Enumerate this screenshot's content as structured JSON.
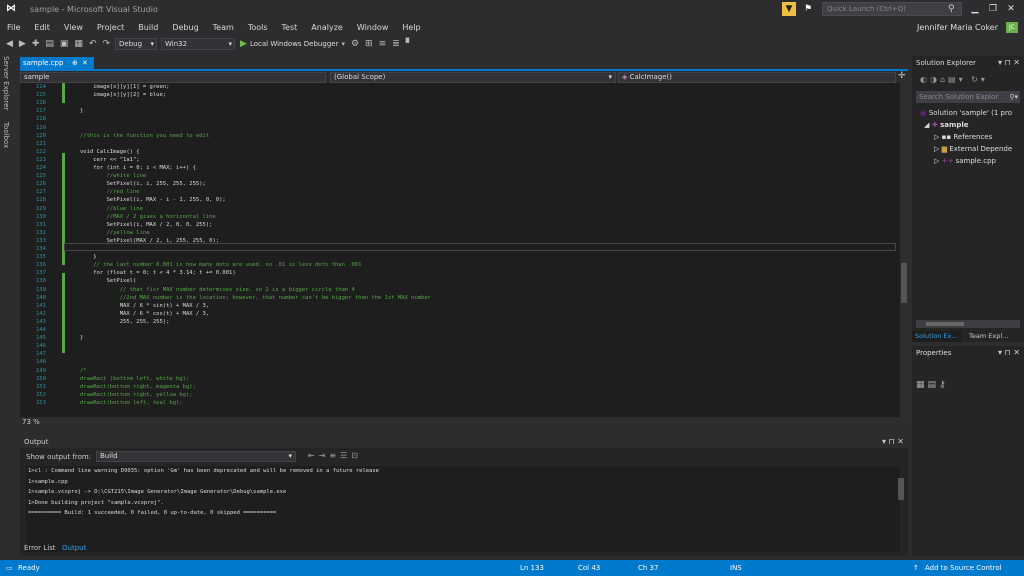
{
  "titlebar": {
    "title": "sample - Microsoft Visual Studio",
    "quick_launch_placeholder": "Quick Launch (Ctrl+Q)"
  },
  "menu": [
    "File",
    "Edit",
    "View",
    "Project",
    "Build",
    "Debug",
    "Team",
    "Tools",
    "Test",
    "Analyze",
    "Window",
    "Help"
  ],
  "user": {
    "name": "Jennifer Maria Coker",
    "initials": "JC",
    "avatar_color": "#69b04a"
  },
  "toolbar": {
    "config": "Debug",
    "platform": "Win32",
    "run_label": "Local Windows Debugger"
  },
  "left_tabs": [
    "Server Explorer",
    "Toolbox"
  ],
  "editor": {
    "tab_label": "sample.cpp",
    "nav_project": "sample",
    "nav_scope": "(Global Scope)",
    "nav_member": "CalcImage()",
    "zoom": "73 %",
    "lines": [
      {
        "n": "114",
        "code": "    image[x][y][1] = green;"
      },
      {
        "n": "115",
        "code": "    image[x][y][2] = blue;"
      },
      {
        "n": "116",
        "code": ""
      },
      {
        "n": "117",
        "code": "}"
      },
      {
        "n": "118",
        "code": ""
      },
      {
        "n": "119",
        "code": ""
      },
      {
        "n": "120",
        "code": "//this is the function you need to edit"
      },
      {
        "n": "121",
        "code": ""
      },
      {
        "n": "122",
        "code": "void CalcImage() {"
      },
      {
        "n": "123",
        "code": "    cerr << \"1a1\";"
      },
      {
        "n": "124",
        "code": "    for (int i = 0; i < MAX; i++) {"
      },
      {
        "n": "125",
        "code": "        //white line"
      },
      {
        "n": "126",
        "code": "        SetPixel(i, i, 255, 255, 255);"
      },
      {
        "n": "127",
        "code": "        //red line"
      },
      {
        "n": "128",
        "code": "        SetPixel(i, MAX - i - 1, 255, 0, 0);"
      },
      {
        "n": "129",
        "code": "        //blue line"
      },
      {
        "n": "130",
        "code": "        //MAX / 2 gives a horizontal line"
      },
      {
        "n": "131",
        "code": "        SetPixel(i, MAX / 2, 0, 0, 255);"
      },
      {
        "n": "132",
        "code": "        //yellow line"
      },
      {
        "n": "133",
        "code": "        SetPixel(MAX / 2, i, 255, 255, 0);"
      },
      {
        "n": "134",
        "code": ""
      },
      {
        "n": "135",
        "code": "    }"
      },
      {
        "n": "136",
        "code": "    // the last number 0.001 is how many dots are used. so .01 is less dots than .001"
      },
      {
        "n": "137",
        "code": "    for (float t = 0; t < 4 * 3.14; t += 0.001)"
      },
      {
        "n": "138",
        "code": "        SetPixel("
      },
      {
        "n": "139",
        "code": "            // that fisr MAX number determines size. so 2 is a bigger circle than 4"
      },
      {
        "n": "140",
        "code": "            //2nd MAX number is the location; however, that number can't be bigger than the 1st MAX number"
      },
      {
        "n": "141",
        "code": "            MAX / 6 * sin(t) + MAX / 3,"
      },
      {
        "n": "142",
        "code": "            MAX / 6 * cos(t) + MAX / 3,"
      },
      {
        "n": "143",
        "code": "            255, 255, 255);"
      },
      {
        "n": "144",
        "code": ""
      },
      {
        "n": "145",
        "code": "}"
      },
      {
        "n": "146",
        "code": ""
      },
      {
        "n": "147",
        "code": ""
      },
      {
        "n": "148",
        "code": ""
      },
      {
        "n": "149",
        "code": "/*"
      },
      {
        "n": "150",
        "code": "drawRect (bottom left, white bg);"
      },
      {
        "n": "151",
        "code": "drawRect(bottom right, magenta bg);"
      },
      {
        "n": "152",
        "code": "drawRect(bottom right, yellow bg);"
      },
      {
        "n": "153",
        "code": "drawRect(bottom left, teal bg);"
      }
    ]
  },
  "output": {
    "title": "Output",
    "show_from_label": "Show output from:",
    "source": "Build",
    "lines": [
      "1>cl : Command line warning D9035: option 'Gm' has been deprecated and will be removed in a future release",
      "1>sample.cpp",
      "1>sample.vcxproj -> D:\\CGT215\\Image Generator\\Image Generator\\Debug\\sample.exe",
      "1>Done building project \"sample.vcxproj\".",
      "========== Build: 1 succeeded, 0 failed, 0 up-to-date, 0 skipped =========="
    ],
    "tabs": [
      "Error List",
      "Output"
    ]
  },
  "solution_explorer": {
    "title": "Solution Explorer",
    "search_placeholder": "Search Solution Explor",
    "solution": "Solution 'sample' (1 pro",
    "project": "sample",
    "nodes": [
      "References",
      "External Depende",
      "sample.cpp"
    ],
    "tabs": [
      "Solution Ex...",
      "Team Expl..."
    ]
  },
  "properties": {
    "title": "Properties"
  },
  "status": {
    "ready": "Ready",
    "ln": "Ln 133",
    "col": "Col 43",
    "ch": "Ch 37",
    "mode": "INS",
    "source_control": "Add to Source Control"
  }
}
